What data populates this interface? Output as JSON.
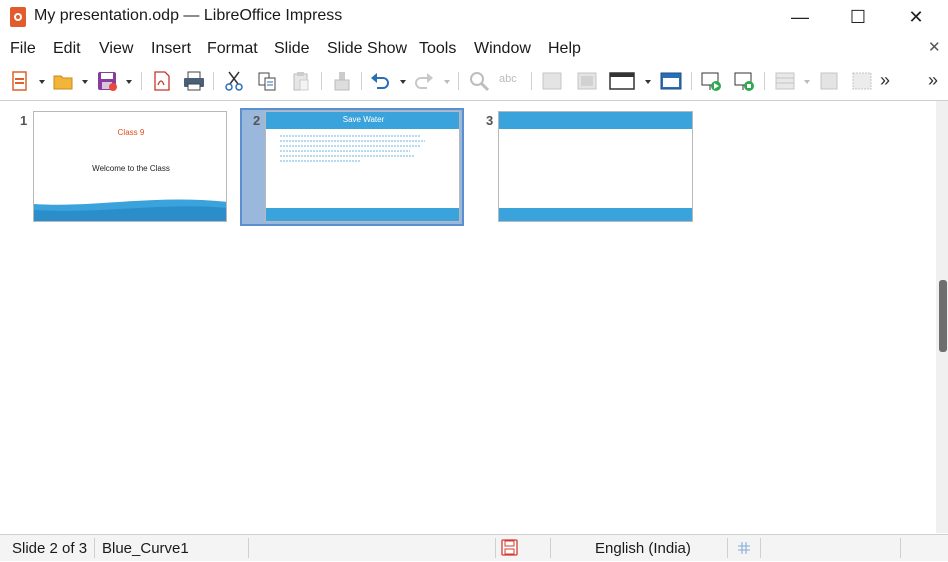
{
  "window": {
    "title": "My presentation.odp — LibreOffice Impress",
    "controls": {
      "minimize": "—",
      "maximize": "☐",
      "close": "✕"
    }
  },
  "menubar": {
    "items": [
      {
        "label": "File"
      },
      {
        "label": "Edit"
      },
      {
        "label": "View"
      },
      {
        "label": "Insert"
      },
      {
        "label": "Format"
      },
      {
        "label": "Slide"
      },
      {
        "label": "Slide Show"
      },
      {
        "label": "Tools"
      },
      {
        "label": "Window"
      },
      {
        "label": "Help"
      }
    ],
    "close_document": "✕"
  },
  "toolbar": {
    "icons": [
      "new-icon",
      "open-icon",
      "save-icon",
      "export-pdf-icon",
      "print-icon",
      "cut-icon",
      "copy-icon",
      "paste-icon",
      "clone-formatting-icon",
      "undo-icon",
      "redo-icon",
      "find-replace-icon",
      "spelling-icon",
      "image-icon",
      "chart-icon",
      "slide-layout-icon",
      "display-views-icon",
      "start-from-first-icon",
      "start-from-current-icon",
      "table-icon",
      "insert-object-icon",
      "more-icon",
      "overflow-icon"
    ],
    "more_label": "»",
    "overflow_label": "»",
    "spelling_label": "abc"
  },
  "slides": [
    {
      "number": "1",
      "title": "Class 9",
      "subtitle": "Welcome to the Class",
      "selected": false
    },
    {
      "number": "2",
      "title": "Save Water",
      "selected": true
    },
    {
      "number": "3",
      "selected": false
    }
  ],
  "status": {
    "slide_info": "Slide 2 of 3",
    "master": "Blue_Curve1",
    "language": "English (India)"
  },
  "colors": {
    "accent_blue": "#3aa3dc",
    "title_orange": "#e04a1c",
    "selection": "#5b8fd0"
  }
}
